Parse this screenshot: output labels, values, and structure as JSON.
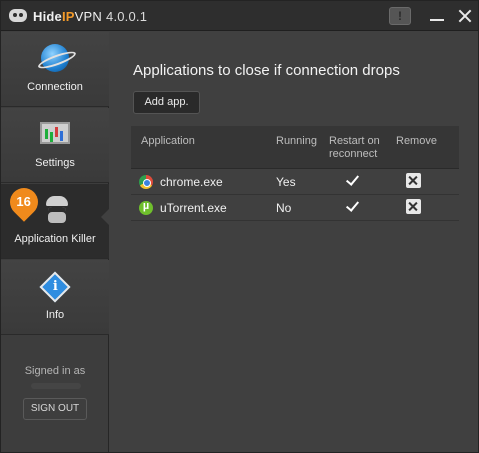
{
  "window": {
    "title_hide": "Hide",
    "title_ip": "IP",
    "title_vpn": "VPN",
    "version": "4.0.0.1",
    "info_label": "!"
  },
  "sidebar": {
    "items": [
      {
        "label": "Connection",
        "icon": "globe-icon"
      },
      {
        "label": "Settings",
        "icon": "monitor-chart-icon"
      },
      {
        "label": "Application Killer",
        "icon": "spy-icon",
        "badge": "16",
        "active": true
      },
      {
        "label": "Info",
        "icon": "info-diamond-icon"
      }
    ],
    "signed_in_as": "Signed in as",
    "sign_out": "SIGN OUT"
  },
  "main": {
    "heading": "Applications to close if connection drops",
    "add_button": "Add app.",
    "columns": {
      "application": "Application",
      "running": "Running",
      "restart": "Restart on reconnect",
      "remove": "Remove"
    },
    "rows": [
      {
        "app": "chrome.exe",
        "icon": "chrome-icon",
        "running": "Yes",
        "restart": true
      },
      {
        "app": "uTorrent.exe",
        "icon": "utorrent-icon",
        "running": "No",
        "restart": true
      }
    ]
  },
  "colors": {
    "accent": "#f39a2a",
    "badge": "#f08a1c",
    "background": "#404040"
  }
}
